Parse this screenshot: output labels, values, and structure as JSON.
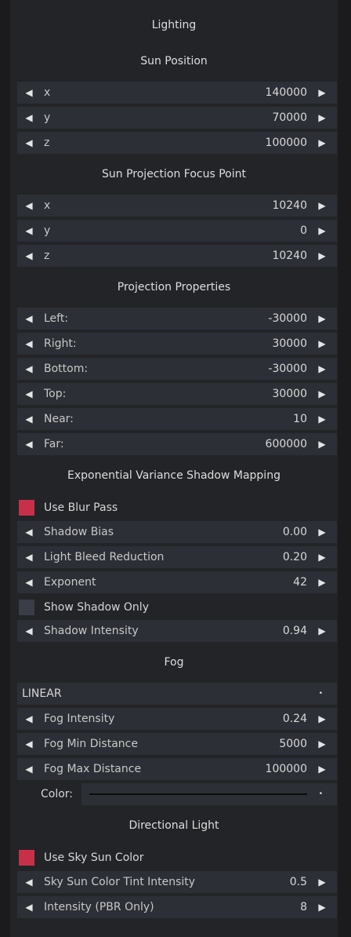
{
  "panel_title": "Lighting",
  "sun_position": {
    "title": "Sun Position",
    "rows": [
      {
        "label": "x",
        "value": "140000"
      },
      {
        "label": "y",
        "value": "70000"
      },
      {
        "label": "z",
        "value": "100000"
      }
    ]
  },
  "sun_focus": {
    "title": "Sun Projection Focus Point",
    "rows": [
      {
        "label": "x",
        "value": "10240"
      },
      {
        "label": "y",
        "value": "0"
      },
      {
        "label": "z",
        "value": "10240"
      }
    ]
  },
  "projection": {
    "title": "Projection Properties",
    "rows": [
      {
        "label": "Left:",
        "value": "-30000"
      },
      {
        "label": "Right:",
        "value": "30000"
      },
      {
        "label": "Bottom:",
        "value": "-30000"
      },
      {
        "label": "Top:",
        "value": "30000"
      },
      {
        "label": "Near:",
        "value": "10"
      },
      {
        "label": "Far:",
        "value": "600000"
      }
    ]
  },
  "evsm": {
    "title": "Exponential Variance Shadow Mapping",
    "use_blur_pass": "Use Blur Pass",
    "shadow_bias": {
      "label": "Shadow Bias",
      "value": "0.00"
    },
    "light_bleed": {
      "label": "Light Bleed Reduction",
      "value": "0.20"
    },
    "exponent": {
      "label": "Exponent",
      "value": "42"
    },
    "show_shadow_only": "Show Shadow Only",
    "shadow_intensity": {
      "label": "Shadow Intensity",
      "value": "0.94"
    }
  },
  "fog": {
    "title": "Fog",
    "mode": "LINEAR",
    "intensity": {
      "label": "Fog Intensity",
      "value": "0.24"
    },
    "min_distance": {
      "label": "Fog Min Distance",
      "value": "5000"
    },
    "max_distance": {
      "label": "Fog Max Distance",
      "value": "100000"
    },
    "color_label": "Color:"
  },
  "directional": {
    "title": "Directional Light",
    "use_sky_sun_color": "Use Sky Sun Color",
    "tint": {
      "label": "Sky Sun Color Tint Intensity",
      "value": "0.5"
    },
    "intensity": {
      "label": "Intensity (PBR Only)",
      "value": "8"
    }
  },
  "arrows": {
    "left": "◀",
    "right": "▶",
    "dropdown": "•"
  },
  "colors": {
    "accent": "#c8304a",
    "row_bg": "#2c2f36",
    "panel_bg": "#232428"
  }
}
